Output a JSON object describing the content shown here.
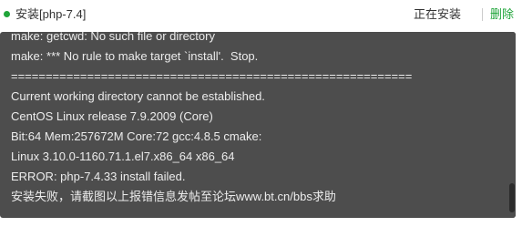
{
  "task": {
    "title": "安装[php-7.4]",
    "status": "正在安装",
    "delete_label": "删除",
    "status_color": "#20a53a"
  },
  "console": {
    "lines": [
      "make: getcwd: No such file or directory",
      "make: *** No rule to make target `install'.  Stop.",
      "==========================================================",
      "Current working directory cannot be established.",
      "CentOS Linux release 7.9.2009 (Core)",
      "Bit:64 Mem:257672M Core:72 gcc:4.8.5 cmake:",
      "Linux 3.10.0-1160.71.1.el7.x86_64 x86_64",
      "ERROR: php-7.4.33 install failed.",
      "安装失败，请截图以上报错信息发帖至论坛www.bt.cn/bbs求助"
    ],
    "background": "#4d4d4d",
    "text_color": "#ececec"
  }
}
